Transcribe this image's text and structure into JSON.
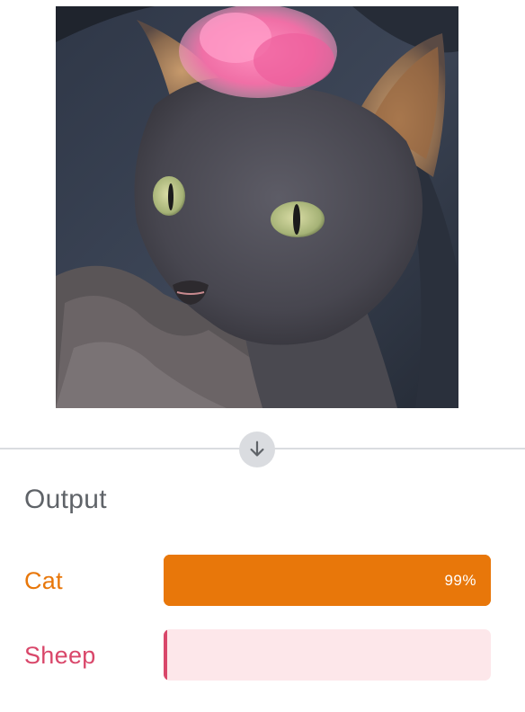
{
  "image": {
    "alt": "Gray Devon Rex cat wearing a pink fluffy hat"
  },
  "divider": {
    "icon": "arrow-down-icon"
  },
  "output": {
    "title": "Output",
    "results": [
      {
        "label": "Cat",
        "score_percent": 99,
        "score_text": "99%",
        "color": "#e8770a",
        "track_color": "#e8770a"
      },
      {
        "label": "Sheep",
        "score_percent": 1,
        "score_text": "",
        "color": "#d9476a",
        "track_color": "#fde7ea"
      }
    ]
  }
}
